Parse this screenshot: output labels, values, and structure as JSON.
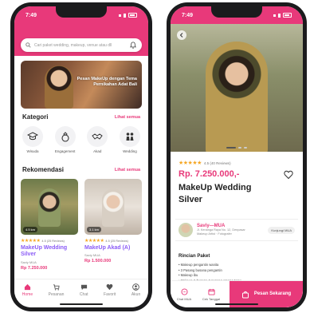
{
  "status": {
    "time": "7:49"
  },
  "home": {
    "search_placeholder": "Cari paket wedding, makeup, venue atau dll",
    "banner_text": "Pesan MakeUp dengan Tema Pernikahan Adat Bali",
    "kategori_title": "Kategori",
    "see_all": "Lihat semua",
    "categories": [
      {
        "label": "Wisuda"
      },
      {
        "label": "Engagement"
      },
      {
        "label": "Akad"
      },
      {
        "label": "Wedding"
      }
    ],
    "rekomendasi_title": "Rekomendasi",
    "products": [
      {
        "badge": "4.5 km",
        "rating": "4.5 (25 Reviews)",
        "name": "MakeUp Wedding Silver",
        "by": "Saviy MUA",
        "price": "Rp 7.250.000"
      },
      {
        "badge": "3.1 km",
        "rating": "4.5 (25 Reviews)",
        "name": "MakeUp Akad (A)",
        "by": "Saviy MUA",
        "price": "Rp 1.500.000"
      }
    ],
    "nav": [
      {
        "label": "Home"
      },
      {
        "label": "Pesanan"
      },
      {
        "label": "Chat"
      },
      {
        "label": "Favorit"
      },
      {
        "label": "Akun"
      }
    ]
  },
  "detail": {
    "rating_text": "4.5 (40 Reviews)",
    "price": "Rp. 7.250.000,-",
    "title": "MakeUp Wedding Silver",
    "vendor": {
      "name": "Saviy—MUA",
      "line1": "Jl. Kenanga Raya No. 12, Denpasar",
      "line2": "Makeup Artist · Fotografer",
      "visit_label": "Kunjungi MUA"
    },
    "rincian_title": "Rincian Paket",
    "rincian_items": [
      "• Makeup pengantin wanita",
      "• 3 Pasang busana pengantin",
      "• Makeup ibu",
      "• Makeup & busana 2 pasang among tamu"
    ],
    "action": {
      "chat_label": "Chat MUA",
      "date_label": "Cek Tanggal",
      "pesan_label": "Pesan Sekarang"
    }
  },
  "colors": {
    "brand": "#e8397a",
    "accent": "#8b5cf6",
    "star": "#f5a623"
  }
}
